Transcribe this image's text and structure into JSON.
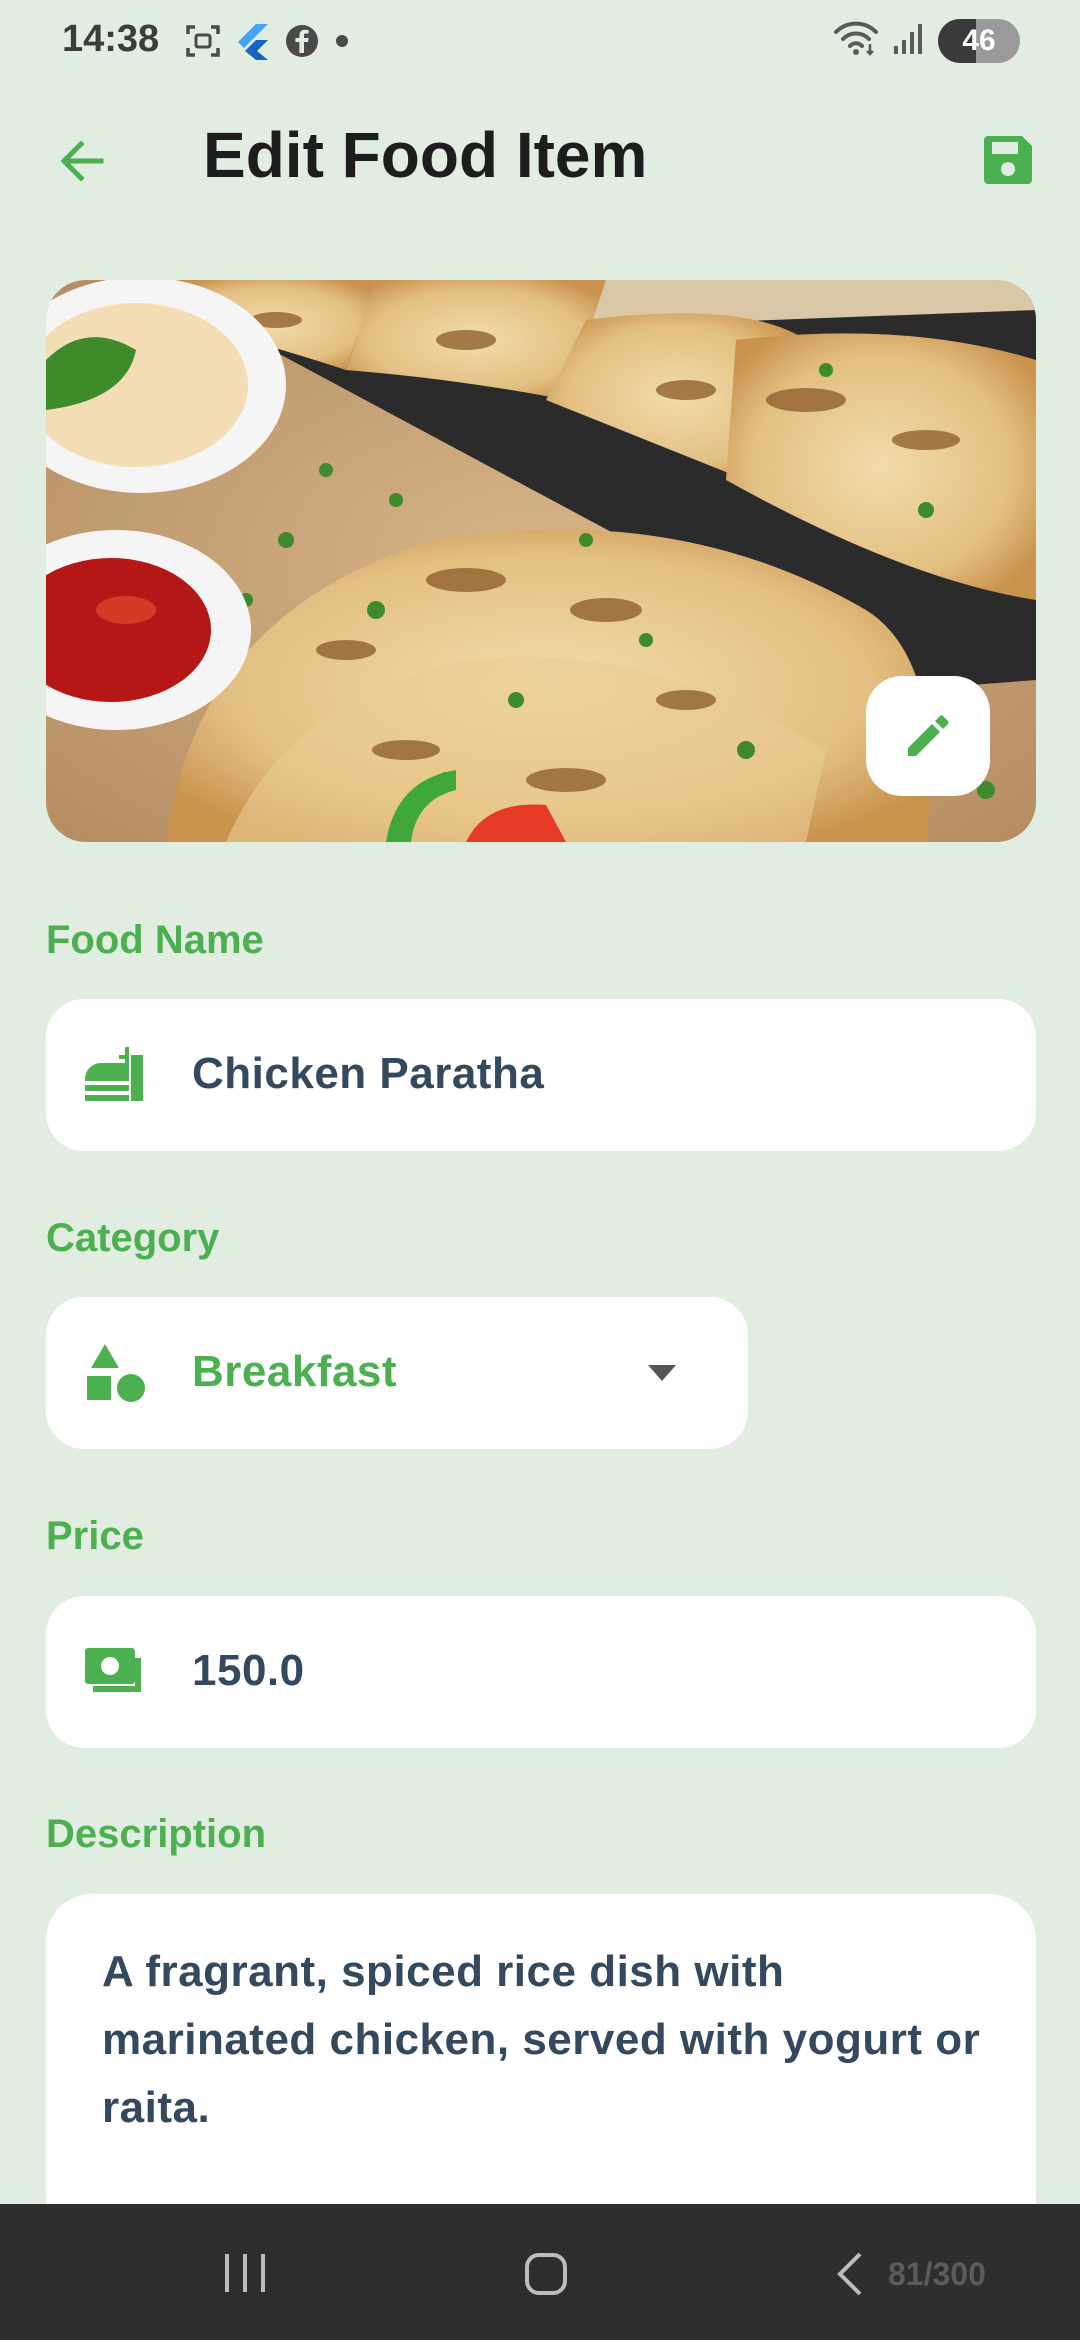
{
  "status_bar": {
    "time": "14:38",
    "battery": "46",
    "icons_left": [
      "screenshot-icon",
      "flutter-icon",
      "facebook-icon",
      "dot-icon"
    ],
    "icons_right": [
      "wifi-icon",
      "signal-icon",
      "battery-icon"
    ]
  },
  "app_bar": {
    "title": "Edit Food Item",
    "back_icon": "arrow-left-icon",
    "save_icon": "save-icon"
  },
  "colors": {
    "background": "#e1ede1",
    "accent": "#4caf50",
    "field_text": "#34495e",
    "nav_bar": "#2e2e2e"
  },
  "form": {
    "food_name": {
      "label": "Food Name",
      "value": "Chicken Paratha",
      "icon": "food-icon"
    },
    "category": {
      "label": "Category",
      "value": "Breakfast",
      "icon": "category-icon"
    },
    "price": {
      "label": "Price",
      "value": "150.0",
      "icon": "money-icon"
    },
    "description": {
      "label": "Description",
      "value": "A fragrant, spiced rice dish with marinated chicken, served with yogurt or raita."
    }
  },
  "nav": {
    "counter": "81/300"
  }
}
